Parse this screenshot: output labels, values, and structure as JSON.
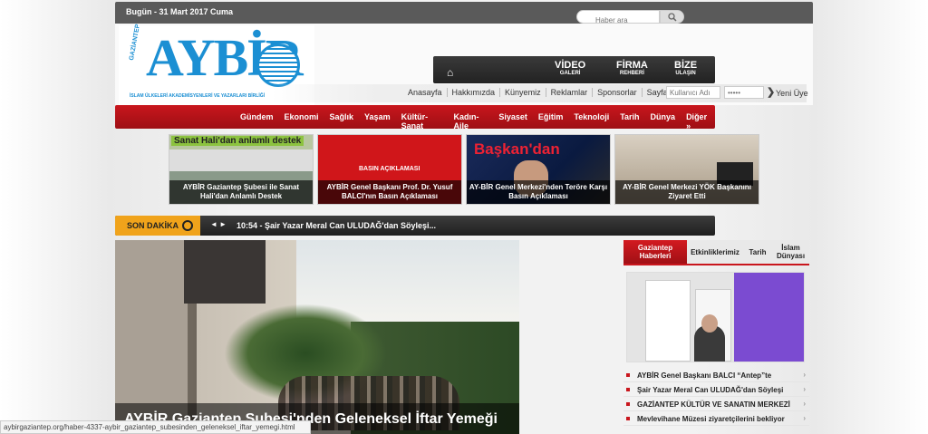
{
  "topbar": {
    "date": "Bugün - 31 Mart 2017 Cuma",
    "search_placeholder": "Haber ara"
  },
  "logo": {
    "brand": "AYBİR",
    "city": "GAZİANTEP",
    "subtitle": "İSLAM ÜLKELERİ AKADEMİSYENLERİ VE YAZARLARI BİRLİĞİ"
  },
  "dark_nav": [
    {
      "line1": "VİDEO",
      "line2": "GALERİ"
    },
    {
      "line1": "FİRMA",
      "line2": "REHBERİ"
    },
    {
      "line1": "BİZE",
      "line2": "ULAŞIN"
    }
  ],
  "links": [
    "Anasayfa",
    "Hakkımızda",
    "Künyemiz",
    "Reklamlar",
    "Sponsorlar",
    "Sayfalar"
  ],
  "login": {
    "user_placeholder": "Kullanıcı Adı",
    "pass_placeholder": "•••••",
    "go": "❯",
    "new_user": "Yeni Üye"
  },
  "categories": [
    "Gündem",
    "Ekonomi",
    "Sağlık",
    "Yaşam",
    "Kültür-Sanat",
    "Kadın-Aile",
    "Siyaset",
    "Eğitim",
    "Teknoloji",
    "Tarih",
    "Dünya",
    "Diğer »"
  ],
  "featured": [
    {
      "header": "Sanat Hali'dan anlamlı destek",
      "caption": "AYBİR Gaziantep Şubesi ile Sanat Hali'dan Anlamlı Destek"
    },
    {
      "header": "BASIN AÇIKLAMASI",
      "caption": "AYBİR Genel Başkanı Prof. Dr. Yusuf BALCI'nın Basın Açıklaması"
    },
    {
      "header": "Başkan'dan",
      "caption": "AY-BİR Genel Merkezi'nden Teröre Karşı Basın Açıklaması"
    },
    {
      "header": "",
      "caption": "AY-BİR Genel Merkezi YÖK Başkanını Ziyaret Etti"
    }
  ],
  "breaking": {
    "label": "SON DAKİKA",
    "arrows": "◄ ►",
    "text": "10:54 - Şair Yazar Meral Can ULUDAĞ'dan Söyleşi..."
  },
  "main_story": {
    "title": "AYBİR Gaziantep Şubesi'nden Geleneksel İftar Yemeği"
  },
  "tabs": [
    "Gaziantep Haberleri",
    "Etkinliklerimiz",
    "Tarih",
    "İslam Dünyası"
  ],
  "news_list": [
    "AYBİR Genel Başkanı BALCI “Antep”te",
    "Şair Yazar Meral Can ULUDAĞ'dan Söyleşi",
    "GAZİANTEP KÜLTÜR VE SANATIN MERKEZİ",
    "Mevlevihane Müzesi ziyaretçilerini bekliyor"
  ],
  "status_url": "aybirgaziantep.org/haber-4337-aybir_gaziantep_subesinden_geleneksel_iftar_yemegi.html",
  "colors": {
    "accent": "#c9161d",
    "brand": "#1b8fd3",
    "breaking": "#f0a31b"
  }
}
